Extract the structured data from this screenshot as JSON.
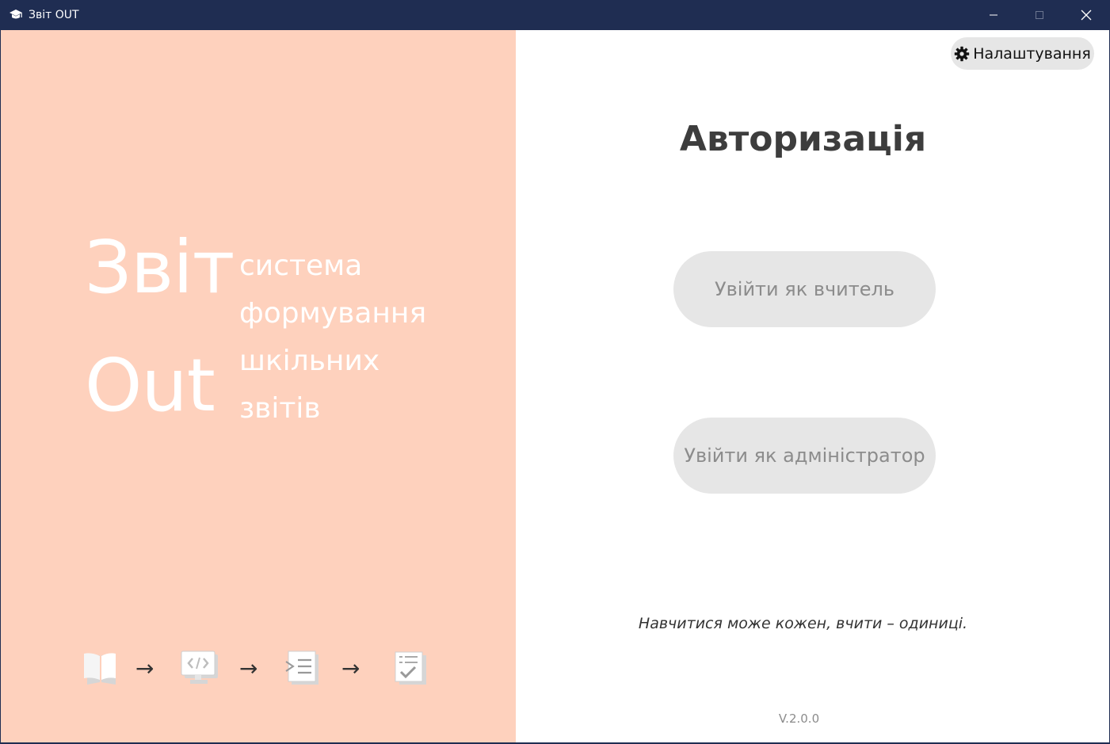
{
  "window": {
    "title": "Звіт OUT",
    "app_icon": "graduation-cap-icon",
    "controls": [
      "minimize-icon",
      "maximize-icon",
      "close-icon"
    ]
  },
  "brand": {
    "word1": "Звіт",
    "word2": "Out",
    "tagline": [
      "система",
      "формування",
      "шкільних",
      "звітів"
    ]
  },
  "workflow": {
    "steps": [
      "book-icon",
      "code-monitor-icon",
      "import-list-icon",
      "checklist-icon"
    ],
    "arrow": "→"
  },
  "settings": {
    "label": "Налаштування",
    "icon": "gear-icon"
  },
  "auth": {
    "title": "Авторизація",
    "teacher_button": "Увійти як вчитель",
    "admin_button": "Увійти як адміністратор"
  },
  "quote": "Навчитися може кожен, вчити – одиниці.",
  "version": "V.2.0.0",
  "colors": {
    "titlebar": "#1f2d52",
    "left_panel": "#fed1bd",
    "button_bg": "#e6e6e6",
    "button_text": "#8c8c8c"
  }
}
